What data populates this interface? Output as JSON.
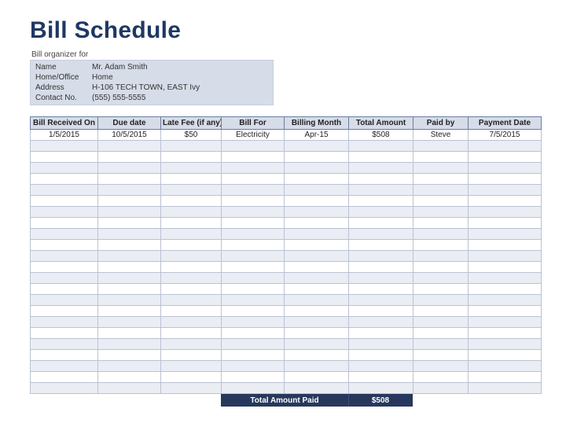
{
  "title": "Bill Schedule",
  "organizer": {
    "heading": "Bill organizer for",
    "fields": {
      "name_label": "Name",
      "name_value": "Mr. Adam Smith",
      "home_office_label": "Home/Office",
      "home_office_value": "Home",
      "address_label": "Address",
      "address_value": "H-106 TECH TOWN, EAST Ivy",
      "contact_label": "Contact No.",
      "contact_value": "(555) 555-5555"
    }
  },
  "columns": [
    "Bill Received On",
    "Due date",
    "Late Fee (if any)",
    "Bill For",
    "Billing Month",
    "Total Amount",
    "Paid by",
    "Payment Date"
  ],
  "rows": [
    {
      "received": "1/5/2015",
      "due": "10/5/2015",
      "late_fee": "$50",
      "for": "Electricity",
      "month": "Apr-15",
      "amount": "$508",
      "paid_by": "Steve",
      "payment_date": "7/5/2015"
    },
    {
      "received": "",
      "due": "",
      "late_fee": "",
      "for": "",
      "month": "",
      "amount": "",
      "paid_by": "",
      "payment_date": ""
    },
    {
      "received": "",
      "due": "",
      "late_fee": "",
      "for": "",
      "month": "",
      "amount": "",
      "paid_by": "",
      "payment_date": ""
    },
    {
      "received": "",
      "due": "",
      "late_fee": "",
      "for": "",
      "month": "",
      "amount": "",
      "paid_by": "",
      "payment_date": ""
    },
    {
      "received": "",
      "due": "",
      "late_fee": "",
      "for": "",
      "month": "",
      "amount": "",
      "paid_by": "",
      "payment_date": ""
    },
    {
      "received": "",
      "due": "",
      "late_fee": "",
      "for": "",
      "month": "",
      "amount": "",
      "paid_by": "",
      "payment_date": ""
    },
    {
      "received": "",
      "due": "",
      "late_fee": "",
      "for": "",
      "month": "",
      "amount": "",
      "paid_by": "",
      "payment_date": ""
    },
    {
      "received": "",
      "due": "",
      "late_fee": "",
      "for": "",
      "month": "",
      "amount": "",
      "paid_by": "",
      "payment_date": ""
    },
    {
      "received": "",
      "due": "",
      "late_fee": "",
      "for": "",
      "month": "",
      "amount": "",
      "paid_by": "",
      "payment_date": ""
    },
    {
      "received": "",
      "due": "",
      "late_fee": "",
      "for": "",
      "month": "",
      "amount": "",
      "paid_by": "",
      "payment_date": ""
    },
    {
      "received": "",
      "due": "",
      "late_fee": "",
      "for": "",
      "month": "",
      "amount": "",
      "paid_by": "",
      "payment_date": ""
    },
    {
      "received": "",
      "due": "",
      "late_fee": "",
      "for": "",
      "month": "",
      "amount": "",
      "paid_by": "",
      "payment_date": ""
    },
    {
      "received": "",
      "due": "",
      "late_fee": "",
      "for": "",
      "month": "",
      "amount": "",
      "paid_by": "",
      "payment_date": ""
    },
    {
      "received": "",
      "due": "",
      "late_fee": "",
      "for": "",
      "month": "",
      "amount": "",
      "paid_by": "",
      "payment_date": ""
    },
    {
      "received": "",
      "due": "",
      "late_fee": "",
      "for": "",
      "month": "",
      "amount": "",
      "paid_by": "",
      "payment_date": ""
    },
    {
      "received": "",
      "due": "",
      "late_fee": "",
      "for": "",
      "month": "",
      "amount": "",
      "paid_by": "",
      "payment_date": ""
    },
    {
      "received": "",
      "due": "",
      "late_fee": "",
      "for": "",
      "month": "",
      "amount": "",
      "paid_by": "",
      "payment_date": ""
    },
    {
      "received": "",
      "due": "",
      "late_fee": "",
      "for": "",
      "month": "",
      "amount": "",
      "paid_by": "",
      "payment_date": ""
    },
    {
      "received": "",
      "due": "",
      "late_fee": "",
      "for": "",
      "month": "",
      "amount": "",
      "paid_by": "",
      "payment_date": ""
    },
    {
      "received": "",
      "due": "",
      "late_fee": "",
      "for": "",
      "month": "",
      "amount": "",
      "paid_by": "",
      "payment_date": ""
    },
    {
      "received": "",
      "due": "",
      "late_fee": "",
      "for": "",
      "month": "",
      "amount": "",
      "paid_by": "",
      "payment_date": ""
    },
    {
      "received": "",
      "due": "",
      "late_fee": "",
      "for": "",
      "month": "",
      "amount": "",
      "paid_by": "",
      "payment_date": ""
    },
    {
      "received": "",
      "due": "",
      "late_fee": "",
      "for": "",
      "month": "",
      "amount": "",
      "paid_by": "",
      "payment_date": ""
    },
    {
      "received": "",
      "due": "",
      "late_fee": "",
      "for": "",
      "month": "",
      "amount": "",
      "paid_by": "",
      "payment_date": ""
    }
  ],
  "footer": {
    "label": "Total Amount Paid",
    "value": "$508"
  }
}
